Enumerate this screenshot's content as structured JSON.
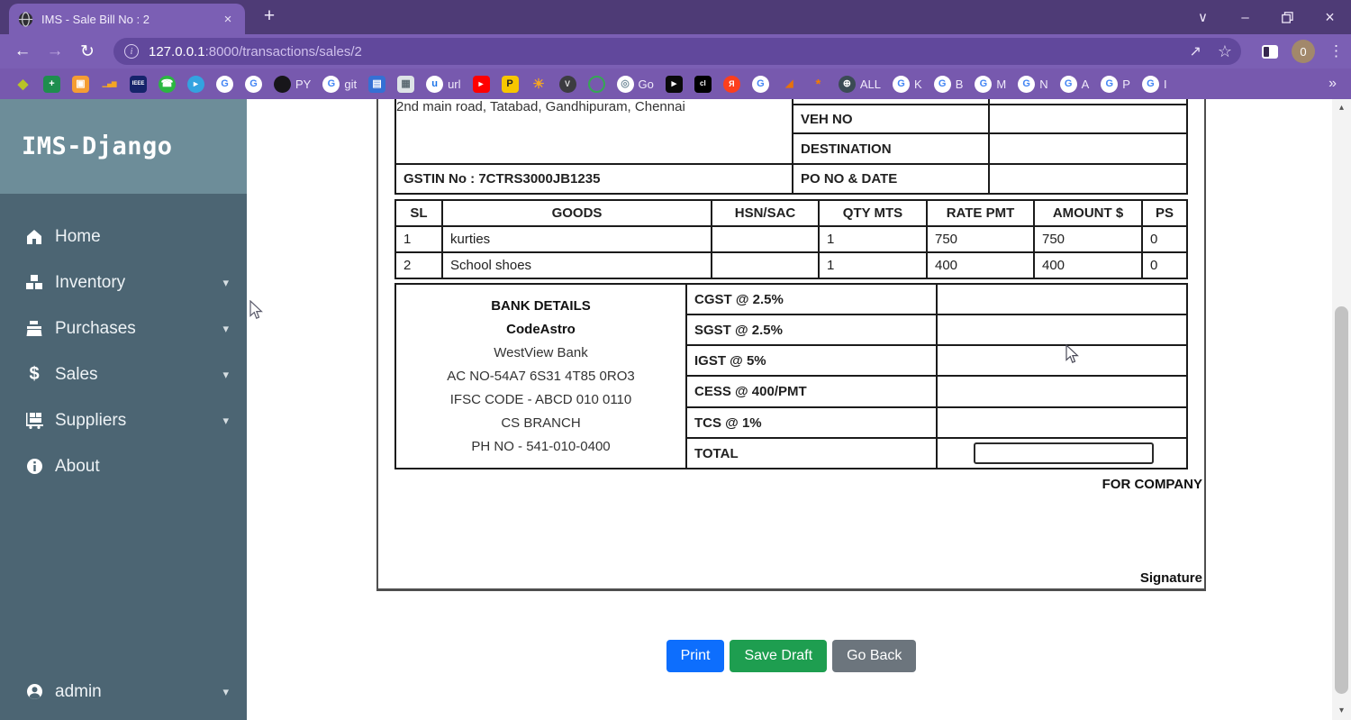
{
  "browser": {
    "tab_title": "IMS - Sale Bill No : 2",
    "url": {
      "host": "127.0.0.1",
      "rest": ":8000/transactions/sales/2"
    },
    "avatar": "0",
    "overflow": "»"
  },
  "icons": {
    "close": "×",
    "minimize": "–",
    "chevron_down": "∨",
    "plus": "+",
    "back": "←",
    "forward": "→",
    "reload": "↻",
    "info": "i",
    "share": "↗",
    "star": "☆",
    "menu": "⋮",
    "caret_down": "▾",
    "scroll_up": "▴",
    "scroll_down": "▾"
  },
  "bookmarks": [
    {
      "name": "bookmark-leaf-icon",
      "glyph": "◆",
      "fg": "#b9c427",
      "shape": "plain"
    },
    {
      "name": "bookmark-green-plus-icon",
      "glyph": "+",
      "bg": "#1e8e4e",
      "fg": "#ffffff",
      "shape": "square"
    },
    {
      "name": "bookmark-orange-app-icon",
      "glyph": "▣",
      "bg": "#f59d33",
      "fg": "#ffffff",
      "shape": "square"
    },
    {
      "name": "bookmark-analytics-icon",
      "glyph": "▁▄▆",
      "fg": "#f5a623",
      "shape": "plain",
      "glyph_size": 7
    },
    {
      "name": "bookmark-ieee-icon",
      "glyph": "IEEE",
      "bg": "#16246b",
      "fg": "#ffffff",
      "shape": "square",
      "glyph_size": 6
    },
    {
      "name": "bookmark-whatsapp-icon",
      "glyph": "☎",
      "bg": "#2bb741",
      "fg": "#ffffff",
      "shape": "circle"
    },
    {
      "name": "bookmark-telegram-icon",
      "glyph": "►",
      "bg": "#33a3e0",
      "fg": "#ffffff",
      "shape": "circle",
      "glyph_size": 9
    },
    {
      "name": "bookmark-google-icon",
      "glyph": "G",
      "bg": "#ffffff",
      "fg": "#4285F4",
      "shape": "circle"
    },
    {
      "name": "bookmark-google-icon",
      "glyph": "G",
      "bg": "#ffffff",
      "fg": "#4285F4",
      "shape": "circle"
    },
    {
      "name": "bookmark-github-icon",
      "glyph": "",
      "bg": "#17161a",
      "shape": "circle",
      "label": "PY"
    },
    {
      "name": "bookmark-google-icon",
      "glyph": "G",
      "bg": "#ffffff",
      "fg": "#4285F4",
      "shape": "circle",
      "label": "git"
    },
    {
      "name": "bookmark-blue-app-icon",
      "glyph": "▤",
      "bg": "#3570d4",
      "fg": "#ffffff",
      "shape": "square"
    },
    {
      "name": "bookmark-calendar-icon",
      "glyph": "▦",
      "bg": "#dde3e6",
      "fg": "#5b6a72",
      "shape": "square"
    },
    {
      "name": "bookmark-url-icon",
      "glyph": "u",
      "bg": "#ffffff",
      "fg": "#1a73e8",
      "shape": "circle",
      "label": "url"
    },
    {
      "name": "bookmark-youtube-icon",
      "glyph": "►",
      "bg": "#ff0000",
      "fg": "#ffffff",
      "shape": "square",
      "glyph_size": 9
    },
    {
      "name": "bookmark-p-icon",
      "glyph": "P",
      "bg": "#f7c600",
      "fg": "#222222",
      "shape": "square"
    },
    {
      "name": "bookmark-orange-emoji-icon",
      "glyph": "☀",
      "fg": "#f5a623",
      "shape": "plain"
    },
    {
      "name": "bookmark-v-icon",
      "glyph": "V",
      "bg": "#3c3c40",
      "fg": "#dddddd",
      "shape": "circle",
      "glyph_size": 9
    },
    {
      "name": "bookmark-green-ring-icon",
      "glyph": "",
      "border": "#35a853",
      "shape": "circle"
    },
    {
      "name": "bookmark-go-icon",
      "glyph": "◎",
      "bg": "#ffffff",
      "fg": "#77909d",
      "shape": "circle",
      "label": "Go"
    },
    {
      "name": "bookmark-black-cursor-icon",
      "glyph": "▸",
      "bg": "#0a0a0a",
      "fg": "#ffffff",
      "shape": "square"
    },
    {
      "name": "bookmark-cl-icon",
      "glyph": "cl",
      "bg": "#000000",
      "fg": "#ffffff",
      "shape": "square",
      "glyph_size": 8
    },
    {
      "name": "bookmark-yandex-icon",
      "glyph": "Я",
      "bg": "#fc3f1d",
      "fg": "#ffffff",
      "shape": "circle",
      "glyph_size": 9
    },
    {
      "name": "bookmark-google-icon",
      "glyph": "G",
      "bg": "#ffffff",
      "fg": "#4285F4",
      "shape": "circle"
    },
    {
      "name": "bookmark-flame-icon",
      "glyph": "◢",
      "fg": "#e8710a",
      "shape": "plain",
      "glyph_size": 11
    },
    {
      "name": "bookmark-orange-dot-icon",
      "glyph": "*",
      "fg": "#f57c00",
      "shape": "plain",
      "glyph_size": 15
    },
    {
      "name": "bookmark-globe-all-icon",
      "glyph": "⊕",
      "bg": "#3b4b54",
      "fg": "#ffffff",
      "shape": "circle",
      "label": "ALL"
    },
    {
      "name": "bookmark-google-icon",
      "glyph": "G",
      "bg": "#ffffff",
      "fg": "#4285F4",
      "shape": "circle",
      "label": "K"
    },
    {
      "name": "bookmark-google-icon",
      "glyph": "G",
      "bg": "#ffffff",
      "fg": "#4285F4",
      "shape": "circle",
      "label": "B"
    },
    {
      "name": "bookmark-google-icon",
      "glyph": "G",
      "bg": "#ffffff",
      "fg": "#4285F4",
      "shape": "circle",
      "label": "M"
    },
    {
      "name": "bookmark-google-icon",
      "glyph": "G",
      "bg": "#ffffff",
      "fg": "#4285F4",
      "shape": "circle",
      "label": "N"
    },
    {
      "name": "bookmark-google-icon",
      "glyph": "G",
      "bg": "#ffffff",
      "fg": "#4285F4",
      "shape": "circle",
      "label": "A"
    },
    {
      "name": "bookmark-google-icon",
      "glyph": "G",
      "bg": "#ffffff",
      "fg": "#4285F4",
      "shape": "circle",
      "label": "P"
    },
    {
      "name": "bookmark-google-icon",
      "glyph": "G",
      "bg": "#ffffff",
      "fg": "#4285F4",
      "shape": "circle",
      "label": "I"
    }
  ],
  "sidebar": {
    "logo": "IMS-Django",
    "items": [
      {
        "label": "Home"
      },
      {
        "label": "Inventory"
      },
      {
        "label": "Purchases"
      },
      {
        "label": "Sales"
      },
      {
        "label": "Suppliers"
      },
      {
        "label": "About"
      }
    ],
    "footer": {
      "label": "admin"
    }
  },
  "invoice": {
    "address": "2nd main road, Tatabad, Gandhipuram, Chennai",
    "gstin": "GSTIN No : 7CTRS3000JB1235",
    "meta": {
      "veh_no": "VEH NO",
      "destination": "DESTINATION",
      "po_no_date": "PO NO & DATE"
    },
    "goods": {
      "headers": [
        "SL",
        "GOODS",
        "HSN/SAC",
        "QTY MTS",
        "RATE PMT",
        "AMOUNT $",
        "PS"
      ],
      "rows": [
        {
          "sl": "1",
          "goods": "kurties",
          "hsn": "",
          "qty": "1",
          "rate": "750",
          "amount": "750",
          "ps": "0"
        },
        {
          "sl": "2",
          "goods": "School shoes",
          "hsn": "",
          "qty": "1",
          "rate": "400",
          "amount": "400",
          "ps": "0"
        }
      ]
    },
    "bank": {
      "lines": [
        "BANK DETAILS",
        "CodeAstro",
        "WestView Bank",
        "AC NO-54A7 6S31 4T85 0RO3",
        "IFSC CODE - ABCD 010 0110",
        "CS BRANCH",
        "PH NO - 541-010-0400"
      ]
    },
    "tax": {
      "rows": [
        "CGST @ 2.5%",
        "SGST @ 2.5%",
        "IGST @ 5%",
        "CESS @ 400/PMT",
        "TCS @ 1%",
        "TOTAL"
      ],
      "total_value": ""
    },
    "for_company": "FOR COMPANY",
    "signature": "Signature"
  },
  "actions": {
    "print": "Print",
    "save_draft": "Save Draft",
    "go_back": "Go Back"
  },
  "colors": {
    "titlebar": "#4e3b76",
    "toolbar": "#7b5fb4",
    "urlbar": "#61489c",
    "bookmarks_bar": "#7759ae",
    "sidebar_header": "#6d8d99",
    "sidebar_body": "#4c6573",
    "btn_print": "#0d6efd",
    "btn_save": "#1e9e50",
    "btn_back": "#6c757d"
  }
}
